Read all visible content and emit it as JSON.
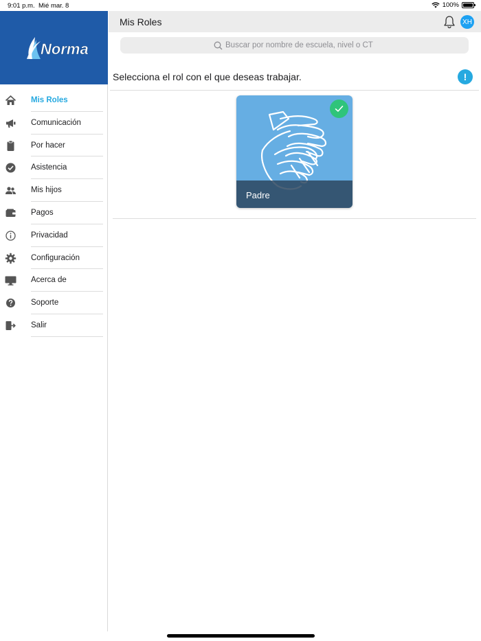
{
  "status_bar": {
    "time": "9:01 p.m.",
    "date": "Mié mar. 8",
    "battery": "100%",
    "battery_level": 1.0
  },
  "brand": {
    "logo_text": "Norma",
    "logo_color": "#1f5ba8"
  },
  "sidebar": {
    "items": [
      {
        "label": "Mis Roles",
        "icon": "home-icon",
        "active": true
      },
      {
        "label": "Comunicación",
        "icon": "megaphone-icon",
        "active": false
      },
      {
        "label": "Por hacer",
        "icon": "clipboard-icon",
        "active": false
      },
      {
        "label": "Asistencia",
        "icon": "check-circle-icon",
        "active": false
      },
      {
        "label": "Mis hijos",
        "icon": "people-icon",
        "active": false
      },
      {
        "label": "Pagos",
        "icon": "wallet-icon",
        "active": false
      },
      {
        "label": "Privacidad",
        "icon": "info-icon",
        "active": false
      },
      {
        "label": "Configuración",
        "icon": "gear-icon",
        "active": false
      },
      {
        "label": "Acerca de",
        "icon": "monitor-icon",
        "active": false
      },
      {
        "label": "Soporte",
        "icon": "question-icon",
        "active": false
      },
      {
        "label": "Salir",
        "icon": "logout-icon",
        "active": false
      }
    ]
  },
  "header": {
    "title": "Mis Roles",
    "avatar_initials": "XH"
  },
  "search": {
    "placeholder": "Buscar por nombre de escuela, nivel o CT"
  },
  "main": {
    "instruction": "Selecciona el rol con el que deseas trabajar.",
    "info_symbol": "!",
    "roles": [
      {
        "label": "Padre",
        "icon": "handshake-icon",
        "selected": true
      }
    ]
  },
  "colors": {
    "accent": "#26a9e0",
    "sidebar_header": "#1f5ba8",
    "card": "#66aee3",
    "check": "#2fc47a"
  }
}
